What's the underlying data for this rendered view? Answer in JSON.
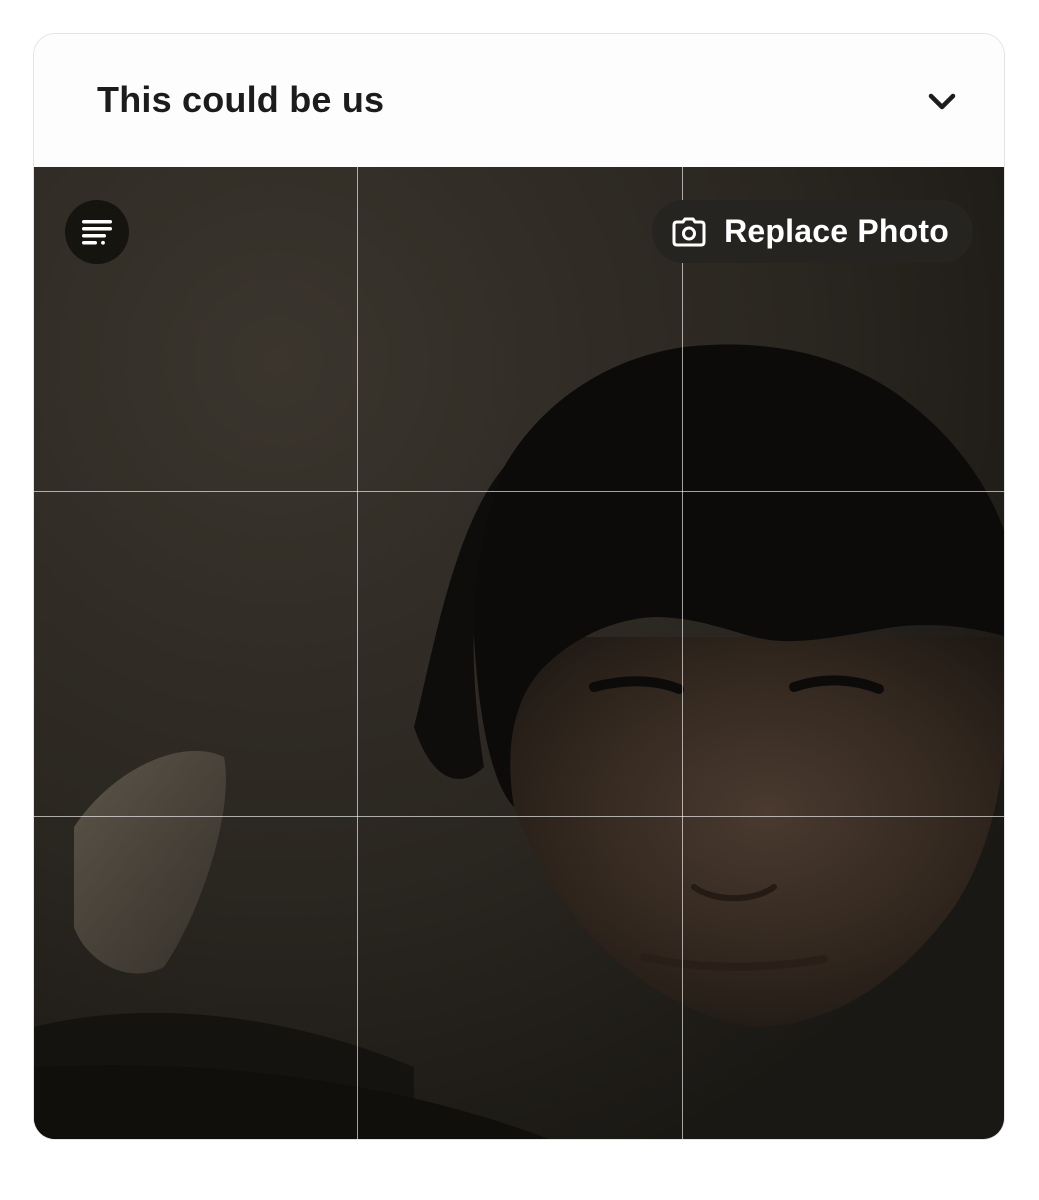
{
  "prompt_card": {
    "title": "This could be us",
    "collapse_icon": "chevron-down-icon"
  },
  "photo": {
    "replace_label": "Replace Photo",
    "replace_icon": "camera-icon",
    "prompt_icon": "text-lines-icon",
    "grid": "3x3"
  },
  "colors": {
    "title_text": "#1c1c1c",
    "button_bg": "#262420",
    "button_text": "#ffffff",
    "photo_tone": "#2b2722"
  }
}
